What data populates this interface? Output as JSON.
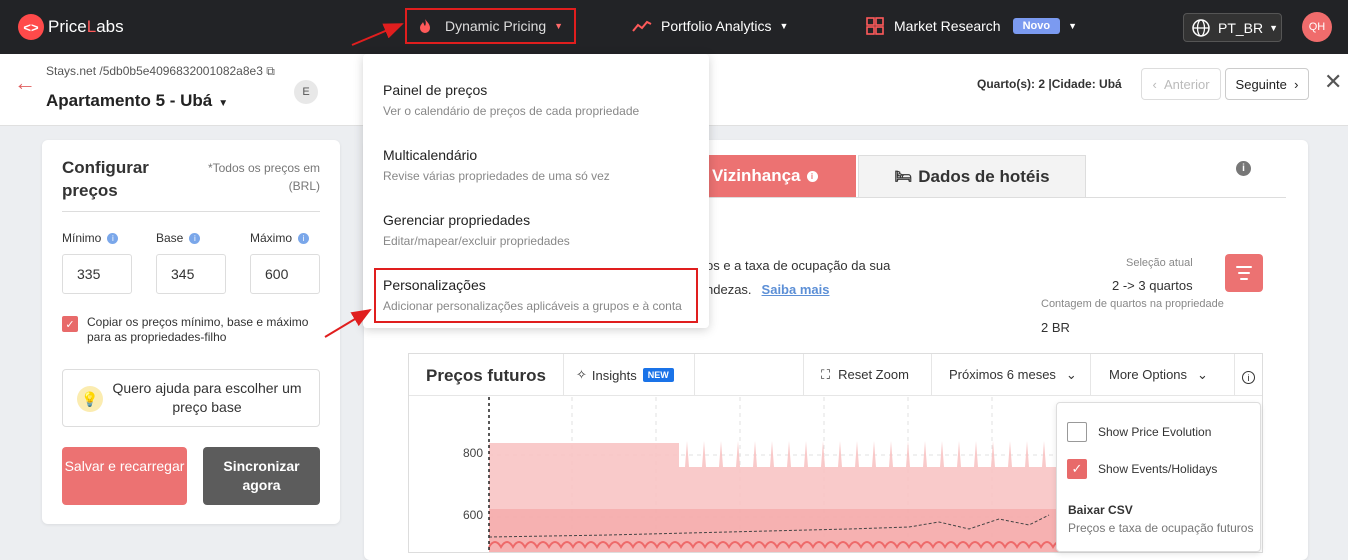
{
  "topbar": {
    "logo_mark": "<>",
    "logo_text_1": "Price",
    "logo_text_2": "L",
    "logo_text_3": "abs",
    "nav_dynamic_pricing": "Dynamic Pricing",
    "nav_portfolio_analytics": "Portfolio Analytics",
    "nav_market_research": "Market Research",
    "novo_badge": "Novo",
    "language": "PT_BR",
    "avatar_initials": "QH"
  },
  "subbar": {
    "listing_id": "Stays.net /5db0b5e4096832001082a8e3",
    "property_name": "Apartamento 5 - Ubá",
    "badge": "E",
    "meta": "Quarto(s):  2  |Cidade:  Ubá",
    "prev_button": "Anterior",
    "next_button": "Seguinte"
  },
  "config": {
    "title": "Configurar preços",
    "note": "*Todos os preços em (BRL)",
    "min_label": "Mínimo",
    "base_label": "Base",
    "max_label": "Máximo",
    "min_value": "335",
    "base_value": "345",
    "max_value": "600",
    "copy_checkbox_label": "Copiar os preços mínimo, base e máximo para as propriedades-filho",
    "help_text": "Quero ajuda para escolher um preço base",
    "save_button": "Salvar e recarregar",
    "sync_button": "Sincronizar agora"
  },
  "tabs": {
    "neighborhood": "Vizinhança",
    "hotels": "Dados de hotéis"
  },
  "description": {
    "line1": "os e a taxa de ocupação da sua",
    "line2": "ndezas.",
    "link": "Saiba mais"
  },
  "selection": {
    "label": "Seleção atual",
    "value": "2 -> 3 quartos",
    "count_label": "Contagem de quartos na propriedade",
    "count_value": "2 BR"
  },
  "chart_header": {
    "title": "Preços futuros",
    "insights": "Insights",
    "new_badge": "NEW",
    "reset_zoom": "Reset Zoom",
    "next_6_months": "Próximos 6 meses",
    "more_options": "More Options"
  },
  "chart_data": {
    "type": "area",
    "y_ticks": [
      "800",
      "600"
    ]
  },
  "more_options_panel": {
    "show_price_evolution": "Show Price Evolution",
    "show_events": "Show Events/Holidays",
    "csv_title": "Baixar CSV",
    "csv_sub": "Preços e taxa de ocupação futuros"
  },
  "dropdown": {
    "items": [
      {
        "title": "Painel de preços",
        "sub": "Ver o calendário de preços de cada propriedade"
      },
      {
        "title": "Multicalendário",
        "sub": "Revise várias propriedades de uma só vez"
      },
      {
        "title": "Gerenciar propriedades",
        "sub": "Editar/mapear/excluir propriedades"
      },
      {
        "title": "Personalizações",
        "sub": "Adicionar personalizações aplicáveis a grupos e à conta"
      }
    ]
  },
  "colors": {
    "accent": "#ec7272",
    "highlight": "#e01e1e",
    "topbar": "#222326"
  }
}
